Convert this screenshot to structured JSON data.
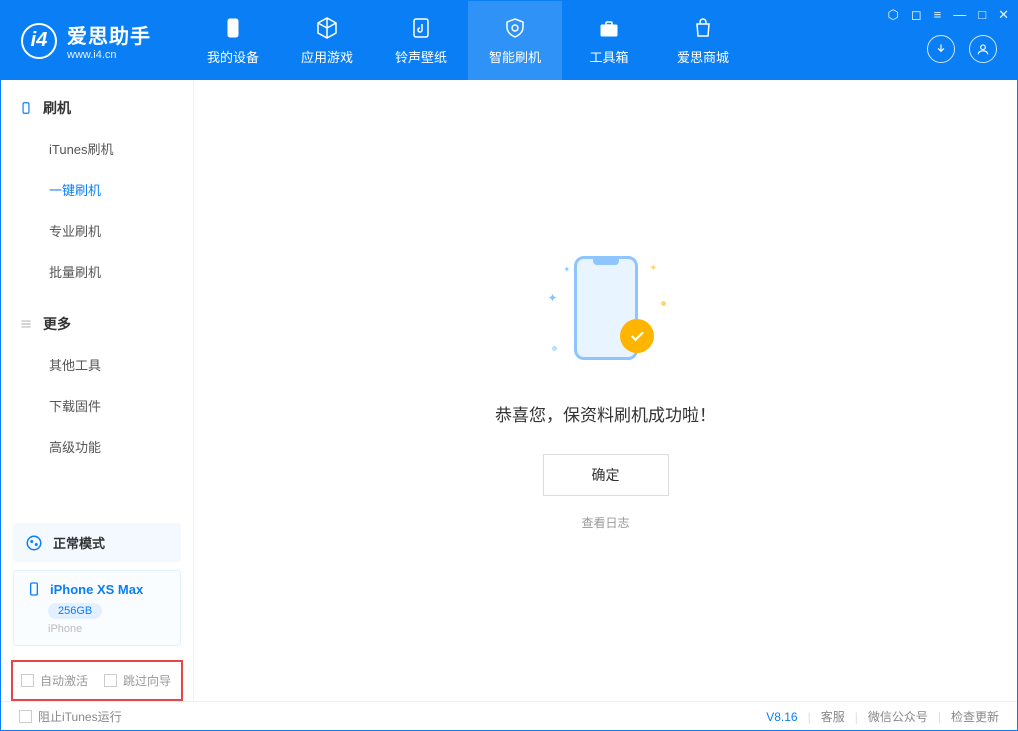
{
  "app": {
    "title": "爱思助手",
    "subtitle": "www.i4.cn"
  },
  "nav": {
    "items": [
      {
        "label": "我的设备"
      },
      {
        "label": "应用游戏"
      },
      {
        "label": "铃声壁纸"
      },
      {
        "label": "智能刷机"
      },
      {
        "label": "工具箱"
      },
      {
        "label": "爱思商城"
      }
    ]
  },
  "sidebar": {
    "section1": {
      "title": "刷机",
      "items": [
        "iTunes刷机",
        "一键刷机",
        "专业刷机",
        "批量刷机"
      ]
    },
    "section2": {
      "title": "更多",
      "items": [
        "其他工具",
        "下载固件",
        "高级功能"
      ]
    },
    "status": "正常模式",
    "device": {
      "name": "iPhone XS Max",
      "storage": "256GB",
      "type": "iPhone"
    },
    "checkboxes": {
      "auto_activate": "自动激活",
      "skip_wizard": "跳过向导"
    }
  },
  "main": {
    "success_message": "恭喜您，保资料刷机成功啦！",
    "ok_button": "确定",
    "view_log": "查看日志"
  },
  "footer": {
    "block_itunes": "阻止iTunes运行",
    "version": "V8.16",
    "links": [
      "客服",
      "微信公众号",
      "检查更新"
    ]
  }
}
